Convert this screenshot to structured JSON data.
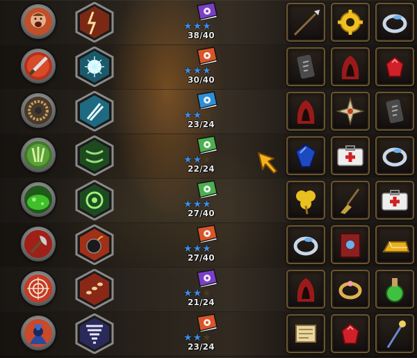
{
  "rows": [
    {
      "progress": "38/40",
      "stars": 3,
      "book_color": "#7a3fc7",
      "circle": "warcry-icon",
      "hex": "lightning-burst-icon",
      "items": [
        "spear-icon",
        "gear-icon",
        "ring-icon"
      ]
    },
    {
      "progress": "30/40",
      "stars": 3,
      "book_color": "#d9552a",
      "circle": "blade-slash-icon",
      "hex": "frost-orb-icon",
      "items": [
        "rune-tablet-icon",
        "red-hood-icon",
        "ruby-gem-icon"
      ]
    },
    {
      "progress": "23/24",
      "stars": 2,
      "book_color": "#2f8fd6",
      "circle": "bear-trap-icon",
      "hex": "daggers-icon",
      "items": [
        "red-hood-icon",
        "throwing-star-icon",
        "rune-tablet-icon"
      ]
    },
    {
      "progress": "22/24",
      "stars": 2,
      "book_color": "#4caf50",
      "circle": "poison-claw-icon",
      "hex": "vine-icon",
      "items": [
        "sapphire-gem-icon",
        "medkit-icon",
        "ring-icon"
      ]
    },
    {
      "progress": "27/40",
      "stars": 3,
      "book_color": "#4caf50",
      "circle": "slime-pool-icon",
      "hex": "poison-swirl-icon",
      "items": [
        "clover-icon",
        "broom-icon",
        "medkit-icon"
      ]
    },
    {
      "progress": "27/40",
      "stars": 3,
      "book_color": "#d9552a",
      "circle": "axe-strike-icon",
      "hex": "bomb-icon",
      "items": [
        "ring-icon",
        "spellbook-icon",
        "gold-bar-icon"
      ]
    },
    {
      "progress": "21/24",
      "stars": 2,
      "book_color": "#7a3fc7",
      "circle": "target-icon",
      "hex": "fire-trail-icon",
      "items": [
        "red-hood-icon",
        "gold-ring-icon",
        "potion-icon"
      ]
    },
    {
      "progress": "23/24",
      "stars": 2,
      "book_color": "#d9552a",
      "circle": "mage-portrait-icon",
      "hex": "tornado-icon",
      "items": [
        "scroll-icon",
        "ruby-gem-icon",
        "staff-icon"
      ]
    }
  ],
  "max_stars": 3,
  "colors": {
    "star_on": "#3b8ee8",
    "slot_border": "#6b5530",
    "cursor": "#f5b21e"
  }
}
